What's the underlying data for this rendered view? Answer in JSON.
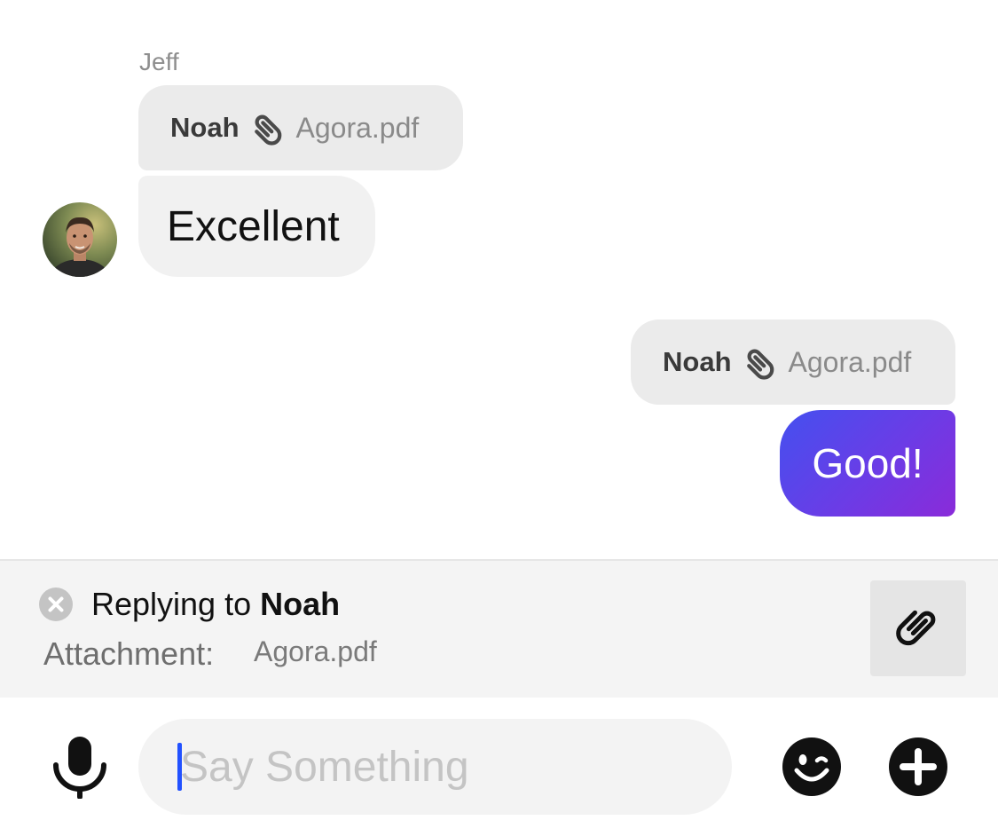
{
  "messages": {
    "incoming": {
      "sender": "Jeff",
      "reply_preview": {
        "name": "Noah",
        "file": "Agora.pdf"
      },
      "text": "Excellent"
    },
    "outgoing": {
      "reply_preview": {
        "name": "Noah",
        "file": "Agora.pdf"
      },
      "text": "Good!"
    }
  },
  "reply_bar": {
    "prefix": "Replying to",
    "name": "Noah",
    "attachment_label": "Attachment:",
    "attachment_file": "Agora.pdf"
  },
  "composer": {
    "placeholder": "Say Something",
    "value": ""
  },
  "colors": {
    "outgoing_bubble_start": "#4450ef",
    "outgoing_bubble_end": "#8a2bd9",
    "caret": "#2251ff"
  },
  "icons": [
    "paperclip-icon",
    "close-icon",
    "microphone-icon",
    "emoji-icon",
    "plus-icon",
    "avatar"
  ]
}
